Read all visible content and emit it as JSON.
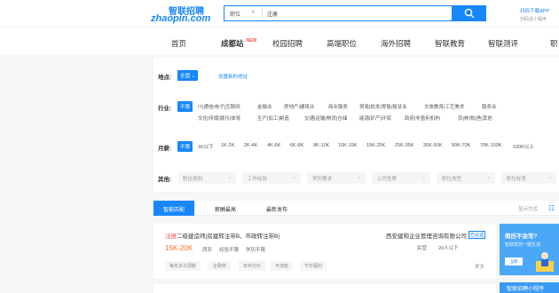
{
  "header": {
    "logo_cn": "智联招聘",
    "logo_en": "zhaopin.com",
    "search_category": "职位",
    "search_value": "注册",
    "app_download": "扫码下载APP",
    "app_sub": "扫码进小程序"
  },
  "nav": {
    "items": [
      "首页",
      "成都站",
      "校园招聘",
      "高端职位",
      "海外招聘",
      "智联教育",
      "智联测评",
      "职"
    ],
    "new_badge": "NEW"
  },
  "filters": {
    "location_label": "地点:",
    "location_value": "全国",
    "location_link": "设置新的地址",
    "industry_label": "行业:",
    "industry_active": "不限",
    "industry_options_row1": [
      "IT|通信|电子|互联网",
      "金融业",
      "房地产|建筑业",
      "商业服务",
      "贸易|批发|零售|租赁业",
      "文体教育|工艺美术",
      "服务业"
    ],
    "industry_options_row2": [
      "文化|传媒|娱乐|体育",
      "生产|加工|制造",
      "交通|运输|物流|仓储",
      "能源|矿产|环保",
      "政府|非盈利机构",
      "农|林|牧|渔|其他"
    ],
    "salary_label": "月薪:",
    "salary_active": "不限",
    "salary_options": [
      "1K以下",
      "1K-2K",
      "2K-4K",
      "4K-6K",
      "6K-8K",
      "8K-10K",
      "10K-15K",
      "15K-25K",
      "25K-35K",
      "35K-50K",
      "50K-70K",
      "70K-100K",
      "100K以上"
    ],
    "other_label": "其他:",
    "dropdowns": [
      "职位类别",
      "工作经验",
      "学历要求",
      "公司性质",
      "职位类型",
      "职位标签"
    ]
  },
  "tabs": {
    "items": [
      "智能匹配",
      "薪酬最高",
      "最新发布"
    ],
    "sort_label": "显示方式"
  },
  "job": {
    "title_highlight": "注册",
    "title_rest": "二级建造师|房建转注带B、市政转注带B|",
    "salary": "15K-20K",
    "requirements": [
      "西安",
      "经验不限",
      "学历不限"
    ],
    "company": "西安建和企业管理咨询有限公司",
    "company_badge": "已认证",
    "company_type": "民营",
    "company_size": "20人以下",
    "welfare": [
      "每年多次调薪",
      "全勤奖",
      "年终分红",
      "不加班",
      "节日福利"
    ],
    "more": "更多"
  },
  "ads": {
    "ad1_title": "简历不会写?",
    "ad1_sub": "智联帮你一键生成",
    "ad1_btn": "立即",
    "ad2_title": "智联招聘小程序"
  },
  "colors": {
    "accent": "#1787fb",
    "salary": "#ff6d24",
    "highlight": "#ff4d4f"
  }
}
